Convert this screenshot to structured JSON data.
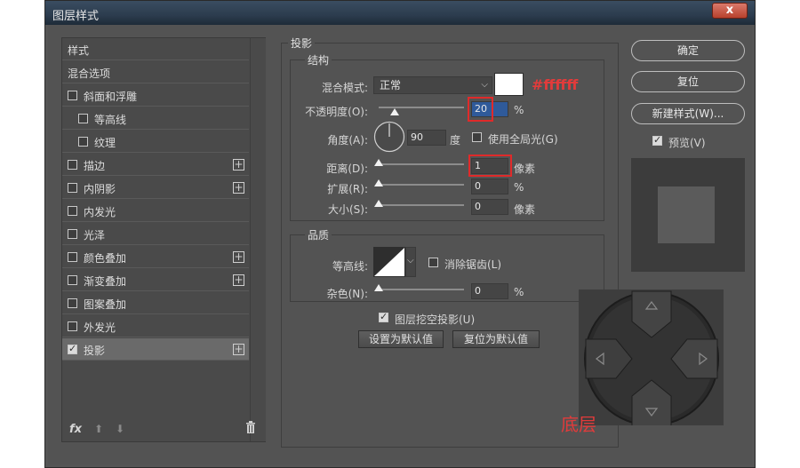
{
  "window": {
    "title": "图层样式",
    "close_label": "x"
  },
  "left_panel": {
    "items": [
      {
        "label": "样式",
        "checkbox": false,
        "checked": false,
        "plus": false,
        "indent": false
      },
      {
        "label": "混合选项",
        "checkbox": false,
        "checked": false,
        "plus": false,
        "indent": false
      },
      {
        "label": "斜面和浮雕",
        "checkbox": true,
        "checked": false,
        "plus": false,
        "indent": false
      },
      {
        "label": "等高线",
        "checkbox": true,
        "checked": false,
        "plus": false,
        "indent": true
      },
      {
        "label": "纹理",
        "checkbox": true,
        "checked": false,
        "plus": false,
        "indent": true
      },
      {
        "label": "描边",
        "checkbox": true,
        "checked": false,
        "plus": true,
        "indent": false
      },
      {
        "label": "内阴影",
        "checkbox": true,
        "checked": false,
        "plus": true,
        "indent": false
      },
      {
        "label": "内发光",
        "checkbox": true,
        "checked": false,
        "plus": false,
        "indent": false
      },
      {
        "label": "光泽",
        "checkbox": true,
        "checked": false,
        "plus": false,
        "indent": false
      },
      {
        "label": "颜色叠加",
        "checkbox": true,
        "checked": false,
        "plus": true,
        "indent": false
      },
      {
        "label": "渐变叠加",
        "checkbox": true,
        "checked": false,
        "plus": true,
        "indent": false
      },
      {
        "label": "图案叠加",
        "checkbox": true,
        "checked": false,
        "plus": false,
        "indent": false
      },
      {
        "label": "外发光",
        "checkbox": true,
        "checked": false,
        "plus": false,
        "indent": false
      },
      {
        "label": "投影",
        "checkbox": true,
        "checked": true,
        "plus": true,
        "indent": false,
        "selected": true
      }
    ],
    "footer_fx": "fx"
  },
  "drop_shadow": {
    "section_title": "投影",
    "structure": {
      "group_title": "结构",
      "blend_mode_label": "混合模式:",
      "blend_mode_value": "正常",
      "color_note": "#ffffff",
      "opacity_label": "不透明度(O):",
      "opacity_value": "20",
      "opacity_unit": "%",
      "angle_label": "角度(A):",
      "angle_value": "90",
      "angle_unit": "度",
      "global_light_label": "使用全局光(G)",
      "distance_label": "距离(D):",
      "distance_value": "1",
      "distance_unit": "像素",
      "spread_label": "扩展(R):",
      "spread_value": "0",
      "spread_unit": "%",
      "size_label": "大小(S):",
      "size_value": "0",
      "size_unit": "像素"
    },
    "quality": {
      "group_title": "品质",
      "contour_label": "等高线:",
      "antialias_label": "消除锯齿(L)",
      "noise_label": "杂色(N):",
      "noise_value": "0",
      "noise_unit": "%"
    },
    "knockout_label": "图层挖空投影(U)",
    "set_default_label": "设置为默认值",
    "reset_default_label": "复位为默认值"
  },
  "right": {
    "ok_label": "确定",
    "reset_label": "复位",
    "new_style_label": "新建样式(W)...",
    "preview_label": "预览(V)"
  },
  "overlay": {
    "layer_label": "底层"
  }
}
